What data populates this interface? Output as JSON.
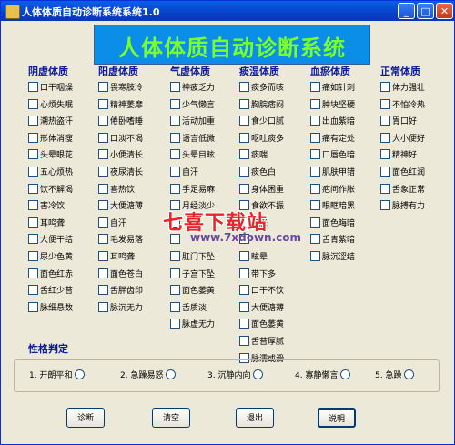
{
  "window": {
    "title": "人体体质自动诊断系统系统1.0",
    "controls": {
      "minimize": "_",
      "maximize": "□",
      "close": "✕"
    }
  },
  "banner": "人体体质自动诊断系统",
  "columns": [
    {
      "title": "阴虚体质",
      "items": [
        "口干咽燥",
        "心烦失眠",
        "潮热盗汗",
        "形体消瘦",
        "头晕眼花",
        "五心烦热",
        "饮不解渴",
        "害冷饮",
        "耳鸣聋",
        "大便干结",
        "尿少色黄",
        "面色红赤",
        "舌红少苔",
        "脉细悬数"
      ]
    },
    {
      "title": "阳虚体质",
      "items": [
        "畏寒肢冷",
        "精神萎靡",
        "倦卧嗜睡",
        "口淡不渴",
        "小便清长",
        "夜尿清长",
        "喜热饮",
        "大便溏薄",
        "自汗",
        "毛发易落",
        "耳鸣聋",
        "面色苍白",
        "舌胖齿印",
        "脉沉无力"
      ]
    },
    {
      "title": "气虚体质",
      "items": [
        "神疲乏力",
        "少气懒言",
        "活动加重",
        "语言低微",
        "头晕目眩",
        "自汗",
        "手足易麻",
        "月经淡少",
        "",
        "",
        "肛门下坠",
        "子宫下坠",
        "面色萎黄",
        "舌质淡",
        "脉虚无力"
      ]
    },
    {
      "title": "痰湿体质",
      "items": [
        "痰多而咳",
        "胸脘痞闷",
        "食少口腻",
        "呕吐痰多",
        "痰喘",
        "痰色白",
        "身体困重",
        "食欲不振",
        "腹胀",
        "",
        "眩晕",
        "带下多",
        "口干不饮",
        "大便溏薄",
        "面色萎黄",
        "舌苔厚腻",
        "脉濡或滑"
      ]
    },
    {
      "title": "血瘀体质",
      "items": [
        "痛如针刺",
        "肿块坚硬",
        "出血紫暗",
        "痛有定处",
        "口唇色暗",
        "肌肤甲错",
        "疤问作胀",
        "眼眶暗黑",
        "面色晦暗",
        "舌青紫暗",
        "脉沉涩结"
      ]
    },
    {
      "title": "正常体质",
      "items": [
        "体力强壮",
        "不怕冷热",
        "胃口好",
        "大小便好",
        "精神好",
        "面色红润",
        "舌象正常",
        "脉搏有力"
      ]
    }
  ],
  "personality": {
    "title": "性格判定",
    "options": [
      "1. 开朗平和",
      "2. 急躁易怒",
      "3. 沉静内向",
      "4. 寡静懒言",
      "5. 急躁"
    ]
  },
  "buttons": {
    "diagnose": "诊断",
    "clear": "清空",
    "exit": "退出",
    "help": "说明"
  },
  "watermark": {
    "text": "七喜下载站",
    "url": "www.7xdown.com"
  }
}
